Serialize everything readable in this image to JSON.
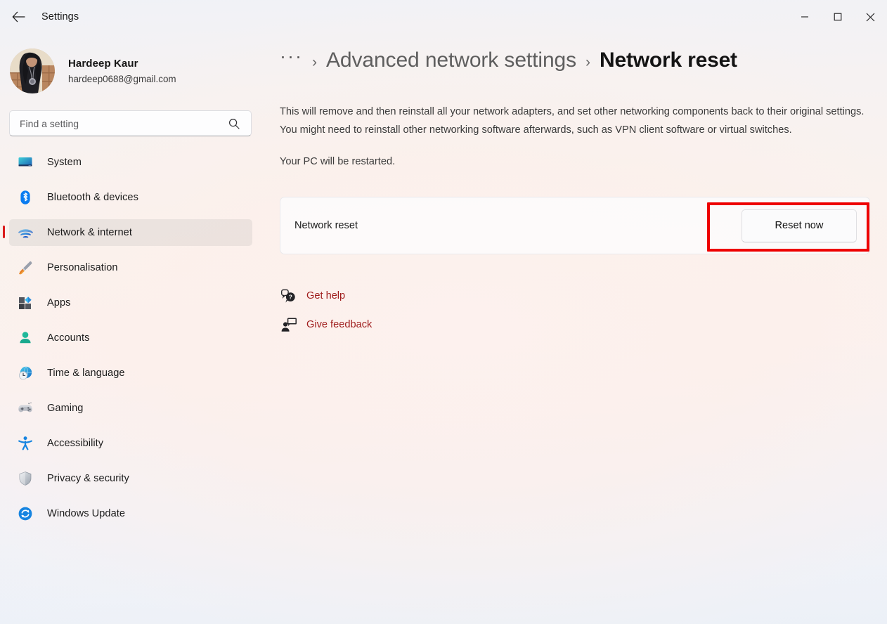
{
  "window": {
    "title": "Settings",
    "back_icon": "back-arrow-icon",
    "controls": {
      "minimize": "minimize-icon",
      "maximize": "maximize-icon",
      "close": "close-icon"
    }
  },
  "account": {
    "name": "Hardeep Kaur",
    "email": "hardeep0688@gmail.com",
    "avatar_icon": "user-avatar-photo"
  },
  "search": {
    "placeholder": "Find a setting",
    "value": "",
    "icon": "search-icon"
  },
  "sidebar": {
    "items": [
      {
        "label": "System",
        "icon": "system-monitor-icon",
        "selected": false
      },
      {
        "label": "Bluetooth & devices",
        "icon": "bluetooth-icon",
        "selected": false
      },
      {
        "label": "Network & internet",
        "icon": "wifi-icon",
        "selected": true
      },
      {
        "label": "Personalisation",
        "icon": "paintbrush-icon",
        "selected": false
      },
      {
        "label": "Apps",
        "icon": "apps-grid-icon",
        "selected": false
      },
      {
        "label": "Accounts",
        "icon": "person-icon",
        "selected": false
      },
      {
        "label": "Time & language",
        "icon": "clock-globe-icon",
        "selected": false
      },
      {
        "label": "Gaming",
        "icon": "gamepad-icon",
        "selected": false
      },
      {
        "label": "Accessibility",
        "icon": "accessibility-person-icon",
        "selected": false
      },
      {
        "label": "Privacy & security",
        "icon": "shield-icon",
        "selected": false
      },
      {
        "label": "Windows Update",
        "icon": "update-refresh-icon",
        "selected": false
      }
    ]
  },
  "breadcrumb": {
    "overflow": "···",
    "separator": "›",
    "parent": "Advanced network settings",
    "current": "Network reset"
  },
  "main": {
    "description": "This will remove and then reinstall all your network adapters, and set other networking components back to their original settings. You might need to reinstall other networking software afterwards, such as VPN client software or virtual switches.",
    "restart_note": "Your PC will be restarted.",
    "card": {
      "label": "Network reset",
      "button_label": "Reset now"
    },
    "annotation_color": "#ee0000"
  },
  "links": [
    {
      "label": "Get help",
      "icon": "help-bubble-icon"
    },
    {
      "label": "Give feedback",
      "icon": "feedback-person-icon"
    }
  ],
  "colors": {
    "accent_bar": "#da1b1b",
    "link": "#9f1c1c",
    "bluetooth": "#0a7cf0",
    "wifi": "#1a8ae5"
  }
}
